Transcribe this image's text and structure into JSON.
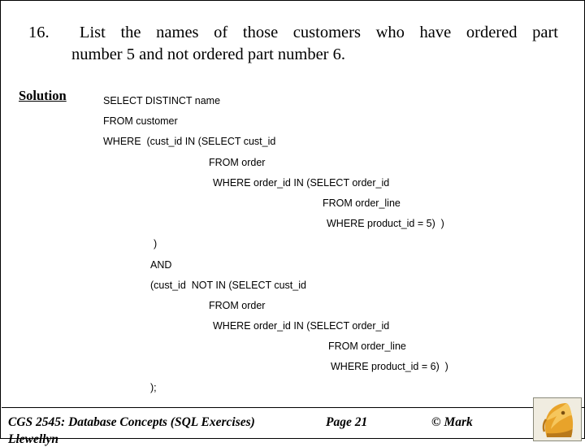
{
  "slide": {
    "question": {
      "number": "16.",
      "line1": "List the names of those customers who have ordered part",
      "line2": "number 5 and not ordered part number 6."
    },
    "solution_label": "Solution",
    "sql_lines": [
      {
        "indent": 0,
        "text": "SELECT DISTINCT name"
      },
      {
        "indent": 0,
        "text": "FROM customer"
      },
      {
        "indent": 0,
        "text": "WHERE  (cust_id IN (SELECT cust_id"
      },
      {
        "indent": 130,
        "text": "FROM order"
      },
      {
        "indent": 135,
        "text": "WHERE order_id IN (SELECT order_id"
      },
      {
        "indent": 270,
        "text": "FROM order_line"
      },
      {
        "indent": 275,
        "text": "WHERE product_id = 5)  )"
      },
      {
        "indent": 62,
        "text": ")"
      },
      {
        "indent": 58,
        "text": "AND"
      },
      {
        "indent": 58,
        "text": "(cust_id  NOT IN (SELECT cust_id"
      },
      {
        "indent": 130,
        "text": "FROM order"
      },
      {
        "indent": 135,
        "text": "WHERE order_id IN (SELECT order_id"
      },
      {
        "indent": 277,
        "text": "FROM order_line"
      },
      {
        "indent": 280,
        "text": "WHERE product_id = 6)  )"
      },
      {
        "indent": 58,
        "text": ");"
      }
    ],
    "footer": {
      "left": "CGS 2545: Database Concepts  (SQL Exercises)",
      "left_wrap": "Llewellyn",
      "center": "Page 21",
      "right": "© Mark"
    },
    "logo": {
      "name": "knight-chess-logo",
      "bg": "#f0ece0",
      "body": "#e8a32a",
      "shade": "#b9791a",
      "dark": "#7a4f10"
    }
  }
}
